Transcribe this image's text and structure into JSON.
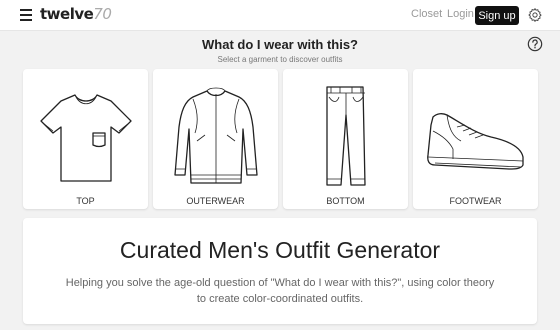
{
  "header": {
    "brand_name": "twelve",
    "brand_number": "70",
    "nav": {
      "closet": "Closet",
      "login": "Login",
      "signup": "Sign up"
    },
    "icons": [
      "menu-icon",
      "gear-icon"
    ]
  },
  "intro": {
    "title": "What do I wear with this?",
    "subtitle": "Select a garment to discover outfits",
    "help_icon": "question-circle-icon"
  },
  "garments": [
    {
      "label": "TOP",
      "icon": "t-shirt-icon"
    },
    {
      "label": "OUTERWEAR",
      "icon": "jacket-icon"
    },
    {
      "label": "BOTTOM",
      "icon": "pants-icon"
    },
    {
      "label": "FOOTWEAR",
      "icon": "sneaker-icon"
    }
  ],
  "hero": {
    "title": "Curated Men's Outfit Generator",
    "description": "Helping you solve the age-old question of \"What do I wear with this?\", using color theory to create color-coordinated outfits."
  },
  "colors": {
    "background": "#f2f2f2",
    "card": "#ffffff",
    "signup_button": "#111111",
    "muted_text": "#9a9a9a"
  }
}
